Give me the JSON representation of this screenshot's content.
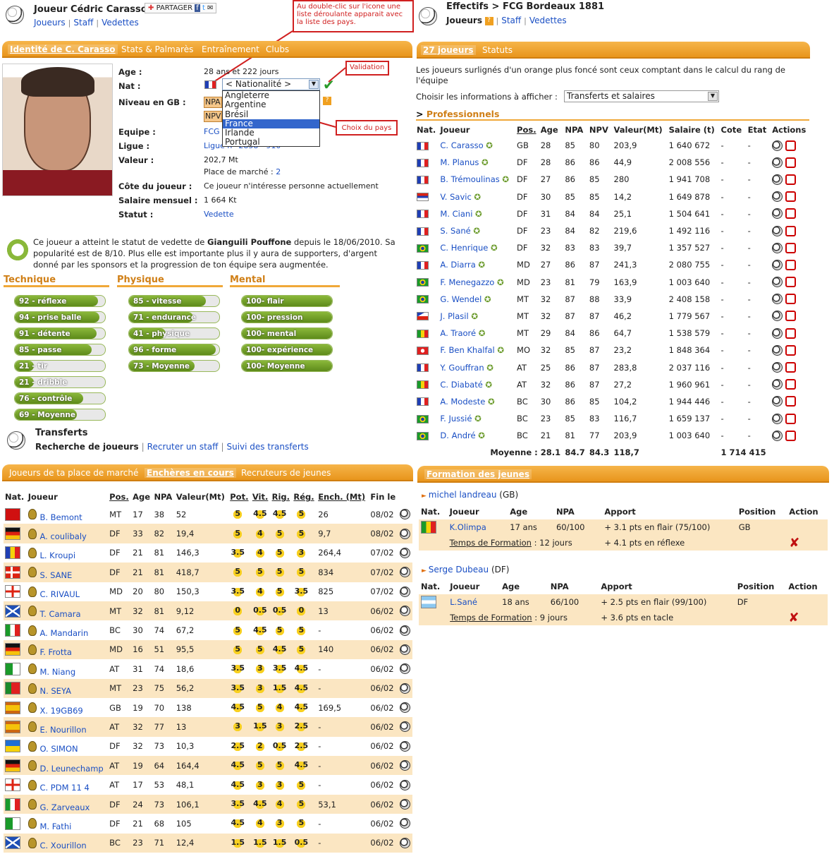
{
  "header_left": {
    "title": "Joueur Cédric Carasso",
    "share": "PARTAGER",
    "nav": [
      "Joueurs",
      "Staff",
      "Vedettes"
    ]
  },
  "header_right": {
    "title": "Effectifs > FCG Bordeaux 1881",
    "nav_current": "Joueurs",
    "nav": [
      "Staff",
      "Vedettes"
    ]
  },
  "callouts": {
    "dropdown": "Au double-clic sur l'icone une liste déroulante apparait avec la liste des pays.",
    "validation": "Validation",
    "country": "Choix du pays"
  },
  "tabs_left": {
    "active": "Identité de C. Carasso",
    "others": [
      "Stats & Palmarès",
      "Entraînement",
      "Clubs"
    ]
  },
  "identity": {
    "age_label": "Age :",
    "age": "28 ans et 222 jours",
    "nat_label": "Nat :",
    "select_value": "< Nationalité >",
    "options": [
      "Angleterre",
      "Argentine",
      "Brésil",
      "France",
      "Irlande",
      "Portugal"
    ],
    "selected_option": "France",
    "niveau_label": "Niveau en GB :",
    "npa": "NPA",
    "npv": "NPV",
    "equipe_label": "Equipe :",
    "equipe": "FCG",
    "ligue_label": "Ligue :",
    "ligue": "Ligue n° 2858 - 910",
    "valeur_label": "Valeur :",
    "valeur": "202,7 Mt",
    "marche_label": "Place de marché :",
    "marche": "2",
    "cote_label": "Côte du joueur :",
    "cote": "Ce joueur n'intéresse personne actuellement",
    "salaire_label": "Salaire mensuel :",
    "salaire": "1 664 Kt",
    "statut_label": "Statut :",
    "statut": "Vedette"
  },
  "vedette_text": {
    "pre": "Ce joueur a atteint le statut de vedette de ",
    "name": "Gianguili Pouffone",
    "post": " depuis le 18/06/2010. Sa popularité est de 8/10. Plus elle est importante plus il y aura de supporters, d'argent donné par les sponsors et la progression de ton équipe sera augmentée."
  },
  "skills": {
    "technique": {
      "title": "Technique",
      "items": [
        {
          "label": "92 - réflexe",
          "value": 92
        },
        {
          "label": "94 - prise balle",
          "value": 94
        },
        {
          "label": "91 - détente",
          "value": 91
        },
        {
          "label": "85 - passe",
          "value": 85
        },
        {
          "label": "21 - tir",
          "value": 21
        },
        {
          "label": "21 - dribble",
          "value": 21
        },
        {
          "label": "76 - contrôle",
          "value": 76
        },
        {
          "label": "69 - Moyenne",
          "value": 69
        }
      ]
    },
    "physique": {
      "title": "Physique",
      "items": [
        {
          "label": "85 - vitesse",
          "value": 85
        },
        {
          "label": "71 - endurance",
          "value": 71
        },
        {
          "label": "41 - physique",
          "value": 41
        },
        {
          "label": "96 - forme",
          "value": 96
        },
        {
          "label": "73 - Moyenne",
          "value": 73
        }
      ]
    },
    "mental": {
      "title": "Mental",
      "items": [
        {
          "label": "100- flair",
          "value": 100
        },
        {
          "label": "100- pression",
          "value": 100
        },
        {
          "label": "100- mental",
          "value": 100
        },
        {
          "label": "100- expérience",
          "value": 100
        },
        {
          "label": "100- Moyenne",
          "value": 100
        }
      ]
    }
  },
  "transferts": {
    "title": "Transferts",
    "sub": "Recherche de joueurs",
    "links": [
      "Recruter un staff",
      "Suivi des transferts"
    ]
  },
  "tabs_right": {
    "active": "27 joueurs",
    "others": [
      "Statuts"
    ]
  },
  "effectif": {
    "note": "Les joueurs surlignés d'un orange plus foncé sont ceux comptant dans le calcul du rang de l'équipe",
    "choose_label": "Choisir les informations à afficher :",
    "choose_value": "Transferts et salaires",
    "section": "Professionnels",
    "headers": [
      "Nat.",
      "Joueur",
      "Pos.",
      "Age",
      "NPA",
      "NPV",
      "Valeur(Mt)",
      "Salaire (t)",
      "Cote",
      "Etat",
      "Actions"
    ],
    "rows": [
      [
        "fr",
        "C. Carasso",
        "GB",
        "28",
        "85",
        "80",
        "203,9",
        "1 640 672",
        "-",
        "-"
      ],
      [
        "fr",
        "M. Planus",
        "DF",
        "28",
        "86",
        "86",
        "44,9",
        "2 008 556",
        "-",
        "-"
      ],
      [
        "fr",
        "B. Trémoulinas",
        "DF",
        "27",
        "86",
        "85",
        "280",
        "1 941 708",
        "-",
        "-"
      ],
      [
        "rs",
        "V. Savic",
        "DF",
        "30",
        "85",
        "85",
        "14,2",
        "1 649 878",
        "-",
        "-"
      ],
      [
        "fr",
        "M. Ciani",
        "DF",
        "31",
        "84",
        "84",
        "25,1",
        "1 504 641",
        "-",
        "-"
      ],
      [
        "fr",
        "S. Sané",
        "DF",
        "23",
        "84",
        "82",
        "219,6",
        "1 492 116",
        "-",
        "-"
      ],
      [
        "br",
        "C. Henrique",
        "DF",
        "32",
        "83",
        "83",
        "39,7",
        "1 357 527",
        "-",
        "-"
      ],
      [
        "fr",
        "A. Diarra",
        "MD",
        "27",
        "86",
        "87",
        "241,3",
        "2 080 755",
        "-",
        "-"
      ],
      [
        "br",
        "F. Menegazzo",
        "MD",
        "23",
        "81",
        "79",
        "163,9",
        "1 003 640",
        "-",
        "-"
      ],
      [
        "br",
        "G. Wendel",
        "MT",
        "32",
        "87",
        "88",
        "33,9",
        "2 408 158",
        "-",
        "-"
      ],
      [
        "cz",
        "J. Plasil",
        "MT",
        "32",
        "87",
        "87",
        "46,2",
        "1 779 567",
        "-",
        "-"
      ],
      [
        "ml",
        "A. Traoré",
        "MT",
        "29",
        "84",
        "86",
        "64,7",
        "1 538 579",
        "-",
        "-"
      ],
      [
        "tn",
        "F. Ben Khalfal",
        "MO",
        "32",
        "85",
        "87",
        "23,2",
        "1 848 364",
        "-",
        "-"
      ],
      [
        "fr",
        "Y. Gouffran",
        "AT",
        "25",
        "86",
        "87",
        "283,8",
        "2 037 116",
        "-",
        "-"
      ],
      [
        "ml",
        "C. Diabaté",
        "AT",
        "32",
        "86",
        "87",
        "27,2",
        "1 960 961",
        "-",
        "-"
      ],
      [
        "fr",
        "A. Modeste",
        "BC",
        "30",
        "86",
        "85",
        "104,2",
        "1 944 446",
        "-",
        "-"
      ],
      [
        "br",
        "F. Jussié",
        "BC",
        "23",
        "85",
        "83",
        "116,7",
        "1 659 137",
        "-",
        "-"
      ],
      [
        "br",
        "D. André",
        "BC",
        "21",
        "81",
        "77",
        "203,9",
        "1 003 640",
        "-",
        "-"
      ]
    ],
    "avg_label": "Moyenne :",
    "avg": [
      "28.1",
      "84.7",
      "84.3",
      "118,7",
      "1 714 415"
    ]
  },
  "market_tabs": {
    "items": [
      "Joueurs de ta place de marché",
      "Enchères en cours",
      "Recruteurs de jeunes"
    ],
    "active": "Enchères en cours"
  },
  "auctions": {
    "headers": [
      "Nat.",
      "Joueur",
      "Pos.",
      "Age",
      "NPA",
      "Valeur(Mt)",
      "Pot.",
      "Vit.",
      "Rig.",
      "Rég.",
      "Ench. (Mt)",
      "Fin le"
    ],
    "rows": [
      [
        "al",
        "B. Bemont",
        "MT",
        "17",
        "38",
        "52",
        "5",
        "4.5",
        "4.5",
        "5",
        "26",
        "08/02"
      ],
      [
        "de",
        "A. coulibaly",
        "DF",
        "33",
        "82",
        "19,4",
        "5",
        "4",
        "5",
        "5",
        "9,7",
        "08/02"
      ],
      [
        "md",
        "L. Kroupi",
        "DF",
        "21",
        "81",
        "146,3",
        "3.5",
        "4",
        "5",
        "3",
        "264,4",
        "07/02"
      ],
      [
        "dk",
        "S. SANE",
        "DF",
        "21",
        "81",
        "418,7",
        "5",
        "5",
        "5",
        "5",
        "834",
        "07/02"
      ],
      [
        "en",
        "C. RIVAUL",
        "MD",
        "20",
        "80",
        "150,3",
        "3.5",
        "4",
        "5",
        "3.5",
        "825",
        "07/02"
      ],
      [
        "sc",
        "T. Camara",
        "MT",
        "32",
        "81",
        "9,12",
        "0",
        "0.5",
        "0.5",
        "0",
        "13",
        "06/02"
      ],
      [
        "it",
        "A. Mandarin",
        "BC",
        "30",
        "74",
        "67,2",
        "5",
        "4.5",
        "5",
        "5",
        "-",
        "06/02"
      ],
      [
        "de",
        "F. Frotta",
        "MD",
        "16",
        "51",
        "95,5",
        "5",
        "5",
        "4.5",
        "5",
        "140",
        "06/02"
      ],
      [
        "dz",
        "M. Niang",
        "AT",
        "31",
        "74",
        "18,6",
        "3.5",
        "3",
        "3.5",
        "4.5",
        "-",
        "06/02"
      ],
      [
        "pt",
        "N. SEYA",
        "MT",
        "23",
        "75",
        "56,2",
        "3.5",
        "3",
        "1.5",
        "4.5",
        "-",
        "06/02"
      ],
      [
        "es",
        "X. 19GB69",
        "GB",
        "19",
        "70",
        "138",
        "4.5",
        "5",
        "4",
        "4.5",
        "169,5",
        "06/02"
      ],
      [
        "es",
        "E. Nourillon",
        "AT",
        "32",
        "77",
        "13",
        "3",
        "1.5",
        "3",
        "2.5",
        "-",
        "06/02"
      ],
      [
        "ua",
        "O. SIMON",
        "DF",
        "32",
        "73",
        "10,3",
        "2.5",
        "2",
        "0.5",
        "2.5",
        "-",
        "06/02"
      ],
      [
        "de",
        "D. Leunechamp",
        "AT",
        "19",
        "64",
        "164,4",
        "4.5",
        "5",
        "5",
        "4.5",
        "-",
        "06/02"
      ],
      [
        "en",
        "C. PDM 11 4",
        "AT",
        "17",
        "53",
        "48,1",
        "4.5",
        "3",
        "3",
        "5",
        "-",
        "06/02"
      ],
      [
        "it",
        "G. Zarveaux",
        "DF",
        "24",
        "73",
        "106,1",
        "3.5",
        "4.5",
        "4",
        "5",
        "53,1",
        "06/02"
      ],
      [
        "dz",
        "M. Fathi",
        "DF",
        "21",
        "68",
        "105",
        "4.5",
        "4",
        "3",
        "5",
        "-",
        "06/02"
      ],
      [
        "sc",
        "C. Xourillon",
        "BC",
        "23",
        "71",
        "12,4",
        "1.5",
        "1.5",
        "1.5",
        "0.5",
        "-",
        "06/02"
      ]
    ]
  },
  "formation": {
    "title": "Formation des jeunes",
    "headers": [
      "Nat.",
      "Joueur",
      "Age",
      "NPA",
      "Apport",
      "Position",
      "Action"
    ],
    "time_label": "Temps de Formation",
    "blocks": [
      {
        "recruiter": "michel landreau",
        "pos": "(GB)",
        "flag": "ml",
        "player": "K.Olimpa",
        "age": "17 ans",
        "npa": "60/100",
        "apport1": "+ 3.1 pts en flair (75/100)",
        "position": "GB",
        "time": ": 12 jours",
        "apport2": "+ 4.1 pts en réflexe"
      },
      {
        "recruiter": "Serge Dubeau",
        "pos": "(DF)",
        "flag": "ar",
        "player": "L.Sané",
        "age": "18 ans",
        "npa": "66/100",
        "apport1": "+ 2.5 pts en flair (99/100)",
        "position": "DF",
        "time": ": 9 jours",
        "apport2": "+ 3.6 pts en tacle"
      }
    ]
  }
}
